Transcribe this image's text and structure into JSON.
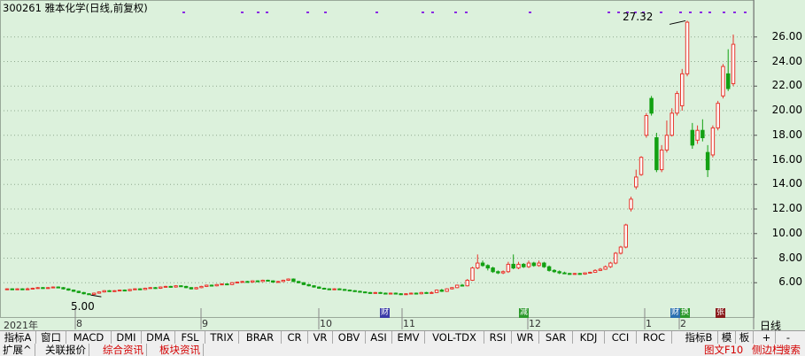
{
  "title": "300261 雅本化学(日线,前复权)",
  "annotations": {
    "high_label": "27.32",
    "low_label": "5.00"
  },
  "x_axis": {
    "year_label": "2021年",
    "months": [
      "8",
      "9",
      "10",
      "11",
      "12",
      "1",
      "2"
    ],
    "period": "日线"
  },
  "event_markers": [
    {
      "text": "财",
      "color": "#3a3aa8"
    },
    {
      "text": "减",
      "color": "#2c9a2c"
    },
    {
      "text": "财",
      "color": "#2a70b0"
    },
    {
      "text": "换",
      "color": "#2c9a2c"
    },
    {
      "text": "张",
      "color": "#8a1c1c"
    }
  ],
  "indicator_tabs": [
    "指标A",
    "窗口",
    "MACD",
    "DMI",
    "DMA",
    "FSL",
    "TRIX",
    "BRAR",
    "CR",
    "VR",
    "OBV",
    "ASI",
    "EMV",
    "VOL-TDX",
    "RSI",
    "WR",
    "SAR",
    "KDJ",
    "CCI",
    "ROC"
  ],
  "right_tabs": [
    "指标B",
    "模",
    "板",
    "+",
    "-"
  ],
  "bottom_tabs": [
    "扩展^",
    "关联报价",
    "综合资讯",
    "板块资讯"
  ],
  "bottom_right_tabs": [
    "图文F10",
    "侧边栏",
    "搜索"
  ],
  "colors": {
    "up": "#e8352c",
    "down": "#13a113",
    "grid": "#8fa98f",
    "background": "#dcf1dc"
  },
  "chart_data": {
    "type": "candlestick",
    "title": "300261 雅本化学(日线,前复权)",
    "ylim": [
      4,
      28
    ],
    "yticks": [
      6,
      8,
      10,
      12,
      14,
      16,
      18,
      20,
      22,
      24,
      26
    ],
    "high_annotation": 27.32,
    "low_annotation": 5.0,
    "x_months": [
      "8",
      "9",
      "10",
      "11",
      "12",
      "1",
      "2"
    ],
    "candles": [
      {
        "o": 5.45,
        "c": 5.5,
        "h": 5.55,
        "l": 5.4
      },
      {
        "o": 5.5,
        "c": 5.45,
        "h": 5.55,
        "l": 5.4
      },
      {
        "o": 5.45,
        "c": 5.5,
        "h": 5.55,
        "l": 5.4
      },
      {
        "o": 5.5,
        "c": 5.45,
        "h": 5.55,
        "l": 5.4
      },
      {
        "o": 5.45,
        "c": 5.5,
        "h": 5.6,
        "l": 5.4
      },
      {
        "o": 5.5,
        "c": 5.55,
        "h": 5.6,
        "l": 5.45
      },
      {
        "o": 5.55,
        "c": 5.6,
        "h": 5.65,
        "l": 5.5
      },
      {
        "o": 5.6,
        "c": 5.55,
        "h": 5.65,
        "l": 5.5
      },
      {
        "o": 5.55,
        "c": 5.6,
        "h": 5.65,
        "l": 5.5
      },
      {
        "o": 5.6,
        "c": 5.65,
        "h": 5.7,
        "l": 5.55
      },
      {
        "o": 5.65,
        "c": 5.6,
        "h": 5.7,
        "l": 5.55
      },
      {
        "o": 5.6,
        "c": 5.5,
        "h": 5.65,
        "l": 5.45
      },
      {
        "o": 5.5,
        "c": 5.4,
        "h": 5.55,
        "l": 5.35
      },
      {
        "o": 5.4,
        "c": 5.3,
        "h": 5.45,
        "l": 5.25
      },
      {
        "o": 5.3,
        "c": 5.2,
        "h": 5.35,
        "l": 5.15
      },
      {
        "o": 5.2,
        "c": 5.1,
        "h": 5.25,
        "l": 5.05
      },
      {
        "o": 5.1,
        "c": 5.05,
        "h": 5.15,
        "l": 5.0
      },
      {
        "o": 5.05,
        "c": 5.15,
        "h": 5.2,
        "l": 5.0
      },
      {
        "o": 5.15,
        "c": 5.25,
        "h": 5.3,
        "l": 5.1
      },
      {
        "o": 5.25,
        "c": 5.35,
        "h": 5.4,
        "l": 5.2
      },
      {
        "o": 5.35,
        "c": 5.3,
        "h": 5.4,
        "l": 5.25
      },
      {
        "o": 5.3,
        "c": 5.35,
        "h": 5.4,
        "l": 5.25
      },
      {
        "o": 5.35,
        "c": 5.4,
        "h": 5.45,
        "l": 5.3
      },
      {
        "o": 5.4,
        "c": 5.35,
        "h": 5.45,
        "l": 5.3
      },
      {
        "o": 5.35,
        "c": 5.45,
        "h": 5.5,
        "l": 5.3
      },
      {
        "o": 5.45,
        "c": 5.5,
        "h": 5.55,
        "l": 5.4
      },
      {
        "o": 5.5,
        "c": 5.45,
        "h": 5.55,
        "l": 5.4
      },
      {
        "o": 5.45,
        "c": 5.55,
        "h": 5.6,
        "l": 5.4
      },
      {
        "o": 5.55,
        "c": 5.6,
        "h": 5.65,
        "l": 5.5
      },
      {
        "o": 5.6,
        "c": 5.55,
        "h": 5.65,
        "l": 5.5
      },
      {
        "o": 5.55,
        "c": 5.65,
        "h": 5.7,
        "l": 5.5
      },
      {
        "o": 5.65,
        "c": 5.7,
        "h": 5.75,
        "l": 5.6
      },
      {
        "o": 5.7,
        "c": 5.65,
        "h": 5.75,
        "l": 5.6
      },
      {
        "o": 5.65,
        "c": 5.75,
        "h": 5.8,
        "l": 5.6
      },
      {
        "o": 5.75,
        "c": 5.7,
        "h": 5.8,
        "l": 5.65
      },
      {
        "o": 5.7,
        "c": 5.6,
        "h": 5.75,
        "l": 5.55
      },
      {
        "o": 5.6,
        "c": 5.5,
        "h": 5.65,
        "l": 5.45
      },
      {
        "o": 5.5,
        "c": 5.6,
        "h": 5.65,
        "l": 5.45
      },
      {
        "o": 5.6,
        "c": 5.7,
        "h": 5.75,
        "l": 5.55
      },
      {
        "o": 5.7,
        "c": 5.8,
        "h": 5.85,
        "l": 5.65
      },
      {
        "o": 5.8,
        "c": 5.75,
        "h": 5.85,
        "l": 5.7
      },
      {
        "o": 5.75,
        "c": 5.85,
        "h": 5.9,
        "l": 5.7
      },
      {
        "o": 5.85,
        "c": 5.9,
        "h": 5.95,
        "l": 5.8
      },
      {
        "o": 5.9,
        "c": 5.85,
        "h": 5.95,
        "l": 5.8
      },
      {
        "o": 5.85,
        "c": 6.0,
        "h": 6.05,
        "l": 5.8
      },
      {
        "o": 6.0,
        "c": 6.05,
        "h": 6.1,
        "l": 5.95
      },
      {
        "o": 6.05,
        "c": 6.1,
        "h": 6.15,
        "l": 6.0
      },
      {
        "o": 6.1,
        "c": 6.05,
        "h": 6.15,
        "l": 6.0
      },
      {
        "o": 6.05,
        "c": 6.15,
        "h": 6.2,
        "l": 6.0
      },
      {
        "o": 6.15,
        "c": 6.1,
        "h": 6.2,
        "l": 6.05
      },
      {
        "o": 6.1,
        "c": 6.2,
        "h": 6.25,
        "l": 6.05
      },
      {
        "o": 6.2,
        "c": 6.15,
        "h": 6.25,
        "l": 6.1
      },
      {
        "o": 6.15,
        "c": 6.05,
        "h": 6.2,
        "l": 6.0
      },
      {
        "o": 6.05,
        "c": 6.1,
        "h": 6.15,
        "l": 6.0
      },
      {
        "o": 6.1,
        "c": 6.2,
        "h": 6.25,
        "l": 6.05
      },
      {
        "o": 6.2,
        "c": 6.3,
        "h": 6.35,
        "l": 6.15
      },
      {
        "o": 6.3,
        "c": 6.1,
        "h": 6.35,
        "l": 6.05
      },
      {
        "o": 6.1,
        "c": 6.0,
        "h": 6.15,
        "l": 5.95
      },
      {
        "o": 6.0,
        "c": 5.85,
        "h": 6.05,
        "l": 5.8
      },
      {
        "o": 5.85,
        "c": 5.75,
        "h": 5.9,
        "l": 5.7
      },
      {
        "o": 5.75,
        "c": 5.65,
        "h": 5.8,
        "l": 5.6
      },
      {
        "o": 5.65,
        "c": 5.55,
        "h": 5.7,
        "l": 5.5
      },
      {
        "o": 5.55,
        "c": 5.5,
        "h": 5.6,
        "l": 5.45
      },
      {
        "o": 5.5,
        "c": 5.45,
        "h": 5.55,
        "l": 5.4
      },
      {
        "o": 5.45,
        "c": 5.5,
        "h": 5.55,
        "l": 5.4
      },
      {
        "o": 5.5,
        "c": 5.45,
        "h": 5.55,
        "l": 5.4
      },
      {
        "o": 5.45,
        "c": 5.4,
        "h": 5.5,
        "l": 5.35
      },
      {
        "o": 5.4,
        "c": 5.35,
        "h": 5.45,
        "l": 5.3
      },
      {
        "o": 5.35,
        "c": 5.3,
        "h": 5.4,
        "l": 5.25
      },
      {
        "o": 5.3,
        "c": 5.25,
        "h": 5.35,
        "l": 5.2
      },
      {
        "o": 5.25,
        "c": 5.2,
        "h": 5.3,
        "l": 5.15
      },
      {
        "o": 5.2,
        "c": 5.15,
        "h": 5.25,
        "l": 5.1
      },
      {
        "o": 5.15,
        "c": 5.2,
        "h": 5.25,
        "l": 5.1
      },
      {
        "o": 5.2,
        "c": 5.15,
        "h": 5.25,
        "l": 5.1
      },
      {
        "o": 5.15,
        "c": 5.1,
        "h": 5.2,
        "l": 5.05
      },
      {
        "o": 5.1,
        "c": 5.15,
        "h": 5.2,
        "l": 5.05
      },
      {
        "o": 5.15,
        "c": 5.1,
        "h": 5.2,
        "l": 5.05
      },
      {
        "o": 5.1,
        "c": 5.05,
        "h": 5.15,
        "l": 5.0
      },
      {
        "o": 5.05,
        "c": 5.1,
        "h": 5.15,
        "l": 5.0
      },
      {
        "o": 5.1,
        "c": 5.15,
        "h": 5.2,
        "l": 5.05
      },
      {
        "o": 5.15,
        "c": 5.1,
        "h": 5.2,
        "l": 5.05
      },
      {
        "o": 5.1,
        "c": 5.2,
        "h": 5.25,
        "l": 5.05
      },
      {
        "o": 5.2,
        "c": 5.15,
        "h": 5.25,
        "l": 5.1
      },
      {
        "o": 5.15,
        "c": 5.2,
        "h": 5.3,
        "l": 5.1
      },
      {
        "o": 5.2,
        "c": 5.4,
        "h": 5.45,
        "l": 5.15
      },
      {
        "o": 5.4,
        "c": 5.3,
        "h": 5.5,
        "l": 5.25
      },
      {
        "o": 5.3,
        "c": 5.5,
        "h": 5.55,
        "l": 5.25
      },
      {
        "o": 5.5,
        "c": 5.6,
        "h": 5.65,
        "l": 5.45
      },
      {
        "o": 5.6,
        "c": 5.8,
        "h": 5.85,
        "l": 5.55
      },
      {
        "o": 5.8,
        "c": 5.75,
        "h": 5.9,
        "l": 5.7
      },
      {
        "o": 5.75,
        "c": 6.2,
        "h": 6.3,
        "l": 5.7
      },
      {
        "o": 6.2,
        "c": 7.2,
        "h": 7.3,
        "l": 6.15
      },
      {
        "o": 7.2,
        "c": 7.6,
        "h": 8.3,
        "l": 7.1
      },
      {
        "o": 7.6,
        "c": 7.4,
        "h": 7.8,
        "l": 7.3
      },
      {
        "o": 7.4,
        "c": 7.2,
        "h": 7.5,
        "l": 7.0
      },
      {
        "o": 7.2,
        "c": 6.9,
        "h": 7.3,
        "l": 6.8
      },
      {
        "o": 6.9,
        "c": 6.8,
        "h": 7.0,
        "l": 6.7
      },
      {
        "o": 6.8,
        "c": 6.9,
        "h": 7.0,
        "l": 6.7
      },
      {
        "o": 6.9,
        "c": 7.5,
        "h": 7.7,
        "l": 6.8
      },
      {
        "o": 7.5,
        "c": 7.2,
        "h": 8.3,
        "l": 7.1
      },
      {
        "o": 7.2,
        "c": 7.5,
        "h": 7.7,
        "l": 7.1
      },
      {
        "o": 7.5,
        "c": 7.3,
        "h": 7.6,
        "l": 7.2
      },
      {
        "o": 7.3,
        "c": 7.6,
        "h": 7.8,
        "l": 7.2
      },
      {
        "o": 7.6,
        "c": 7.4,
        "h": 7.7,
        "l": 7.3
      },
      {
        "o": 7.4,
        "c": 7.6,
        "h": 7.8,
        "l": 7.3
      },
      {
        "o": 7.6,
        "c": 7.3,
        "h": 7.7,
        "l": 7.2
      },
      {
        "o": 7.3,
        "c": 7.0,
        "h": 7.4,
        "l": 6.9
      },
      {
        "o": 7.0,
        "c": 6.9,
        "h": 7.1,
        "l": 6.8
      },
      {
        "o": 6.9,
        "c": 6.8,
        "h": 7.0,
        "l": 6.7
      },
      {
        "o": 6.8,
        "c": 6.75,
        "h": 6.9,
        "l": 6.7
      },
      {
        "o": 6.75,
        "c": 6.7,
        "h": 6.8,
        "l": 6.65
      },
      {
        "o": 6.7,
        "c": 6.75,
        "h": 6.8,
        "l": 6.65
      },
      {
        "o": 6.75,
        "c": 6.7,
        "h": 6.8,
        "l": 6.65
      },
      {
        "o": 6.7,
        "c": 6.8,
        "h": 6.85,
        "l": 6.65
      },
      {
        "o": 6.8,
        "c": 6.85,
        "h": 6.9,
        "l": 6.75
      },
      {
        "o": 6.85,
        "c": 7.0,
        "h": 7.1,
        "l": 6.8
      },
      {
        "o": 7.0,
        "c": 7.1,
        "h": 7.2,
        "l": 6.95
      },
      {
        "o": 7.1,
        "c": 7.3,
        "h": 7.4,
        "l": 7.05
      },
      {
        "o": 7.3,
        "c": 7.6,
        "h": 7.7,
        "l": 7.2
      },
      {
        "o": 7.6,
        "c": 8.4,
        "h": 8.5,
        "l": 7.5
      },
      {
        "o": 8.4,
        "c": 8.9,
        "h": 9.0,
        "l": 8.3
      },
      {
        "o": 8.9,
        "c": 10.7,
        "h": 10.8,
        "l": 8.8
      },
      {
        "o": 12.0,
        "c": 12.8,
        "h": 13.0,
        "l": 11.8
      },
      {
        "o": 13.8,
        "c": 14.6,
        "h": 15.2,
        "l": 13.6
      },
      {
        "o": 14.8,
        "c": 16.2,
        "h": 16.3,
        "l": 14.7
      },
      {
        "o": 18.0,
        "c": 19.6,
        "h": 19.8,
        "l": 17.8
      },
      {
        "o": 21.0,
        "c": 19.8,
        "h": 21.2,
        "l": 19.6
      },
      {
        "o": 17.8,
        "c": 15.2,
        "h": 18.2,
        "l": 15.0
      },
      {
        "o": 15.2,
        "c": 16.8,
        "h": 17.2,
        "l": 15.0
      },
      {
        "o": 16.8,
        "c": 18.0,
        "h": 19.2,
        "l": 16.6
      },
      {
        "o": 18.0,
        "c": 19.8,
        "h": 20.2,
        "l": 17.9
      },
      {
        "o": 19.8,
        "c": 21.4,
        "h": 21.6,
        "l": 19.6
      },
      {
        "o": 20.4,
        "c": 23.0,
        "h": 23.4,
        "l": 20.0
      },
      {
        "o": 23.0,
        "c": 27.2,
        "h": 27.32,
        "l": 22.8
      },
      {
        "o": 18.4,
        "c": 17.2,
        "h": 19.0,
        "l": 16.9
      },
      {
        "o": 17.6,
        "c": 18.4,
        "h": 18.8,
        "l": 17.3
      },
      {
        "o": 18.4,
        "c": 17.8,
        "h": 19.3,
        "l": 17.5
      },
      {
        "o": 16.6,
        "c": 15.2,
        "h": 17.2,
        "l": 14.6
      },
      {
        "o": 16.4,
        "c": 18.6,
        "h": 18.8,
        "l": 16.2
      },
      {
        "o": 18.6,
        "c": 20.6,
        "h": 20.8,
        "l": 18.4
      },
      {
        "o": 21.2,
        "c": 23.6,
        "h": 23.8,
        "l": 21.0
      },
      {
        "o": 23.0,
        "c": 21.8,
        "h": 25.0,
        "l": 21.6
      },
      {
        "o": 22.2,
        "c": 25.4,
        "h": 26.2,
        "l": 22.0
      }
    ]
  }
}
